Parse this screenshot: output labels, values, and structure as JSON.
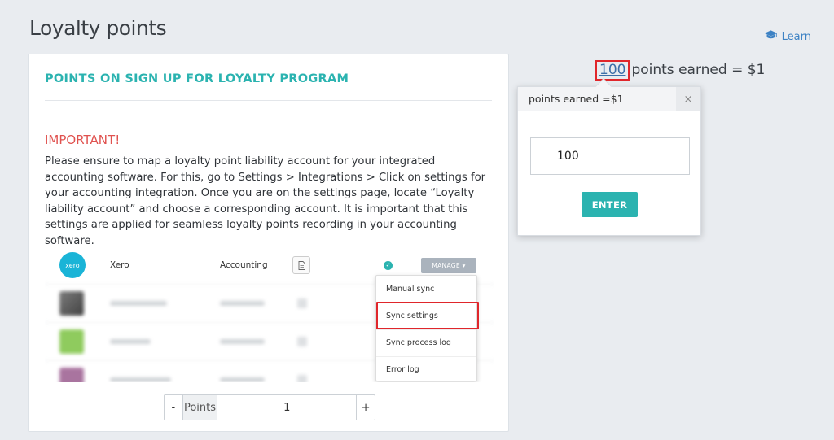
{
  "page": {
    "title": "Loyalty points",
    "learn_label": "Learn"
  },
  "card": {
    "title": "POINTS ON SIGN UP FOR LOYALTY PROGRAM",
    "important_label": "IMPORTANT!",
    "body_text": "Please ensure to map a loyalty point liability account for your integrated accounting software. For this, go to Settings > Integrations > Click on settings for your accounting integration. Once you are on the settings page, locate “Loyalty liability account” and choose a corresponding account. It is important that this settings are applied for seamless loyalty points recording in your accounting software."
  },
  "integration_shot": {
    "row": {
      "logo_text": "xero",
      "name": "Xero",
      "category": "Accounting",
      "manage_label": "MANAGE ▾"
    },
    "menu_items": [
      "Manual sync",
      "Sync settings",
      "Sync process log",
      "Error log"
    ]
  },
  "stepper": {
    "minus": "-",
    "label": "Points",
    "value": "1",
    "plus": "+"
  },
  "earned": {
    "value": "100",
    "suffix": "points earned = $1"
  },
  "popover": {
    "header": "points earned =$1",
    "close": "×",
    "input_value": "100",
    "enter_label": "ENTER"
  },
  "colors": {
    "accent": "#2bb3b0",
    "warning": "#e0524f",
    "highlight": "#e0262b",
    "link": "#3d82c4",
    "background": "#e9ecf0"
  },
  "icons": {
    "learn": "graduation-cap-icon",
    "close": "close-icon",
    "check": "check-icon",
    "document": "document-icon"
  }
}
